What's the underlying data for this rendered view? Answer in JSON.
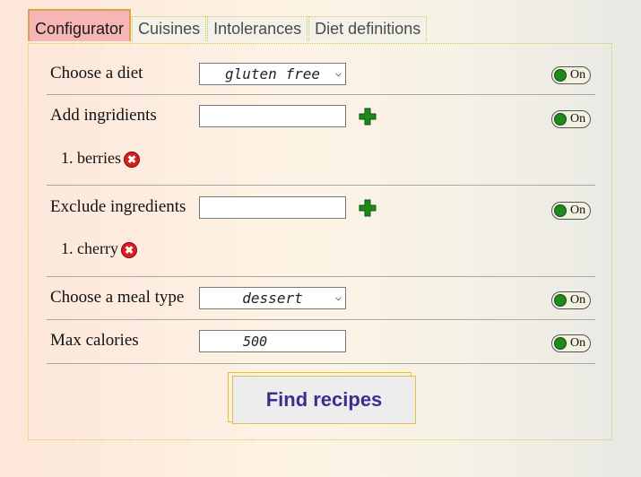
{
  "tabs": [
    {
      "label": "Configurator"
    },
    {
      "label": "Cuisines"
    },
    {
      "label": "Intolerances"
    },
    {
      "label": "Diet definitions"
    }
  ],
  "diet": {
    "label": "Choose a diet",
    "selected": "gluten free",
    "toggle": "On"
  },
  "add_ingredients": {
    "label": "Add ingridients",
    "value": "",
    "toggle": "On",
    "items": [
      "1. berries"
    ]
  },
  "exclude_ingredients": {
    "label": "Exclude ingredients",
    "value": "",
    "toggle": "On",
    "items": [
      "1. cherry"
    ]
  },
  "meal_type": {
    "label": "Choose a meal type",
    "selected": "dessert",
    "toggle": "On"
  },
  "max_calories": {
    "label": "Max calories",
    "value": "500",
    "toggle": "On"
  },
  "find_button": {
    "label": "Find recipes"
  },
  "icons": {
    "add": "plus-icon",
    "remove": "remove-icon",
    "dropdown": "chevron-down-icon"
  },
  "colors": {
    "active_tab": "#f6b6b6",
    "button_text": "#3a2f8f",
    "toggle_on": "#1e8a1e",
    "remove": "#d81e1e",
    "plus": "#1e8a1e"
  }
}
